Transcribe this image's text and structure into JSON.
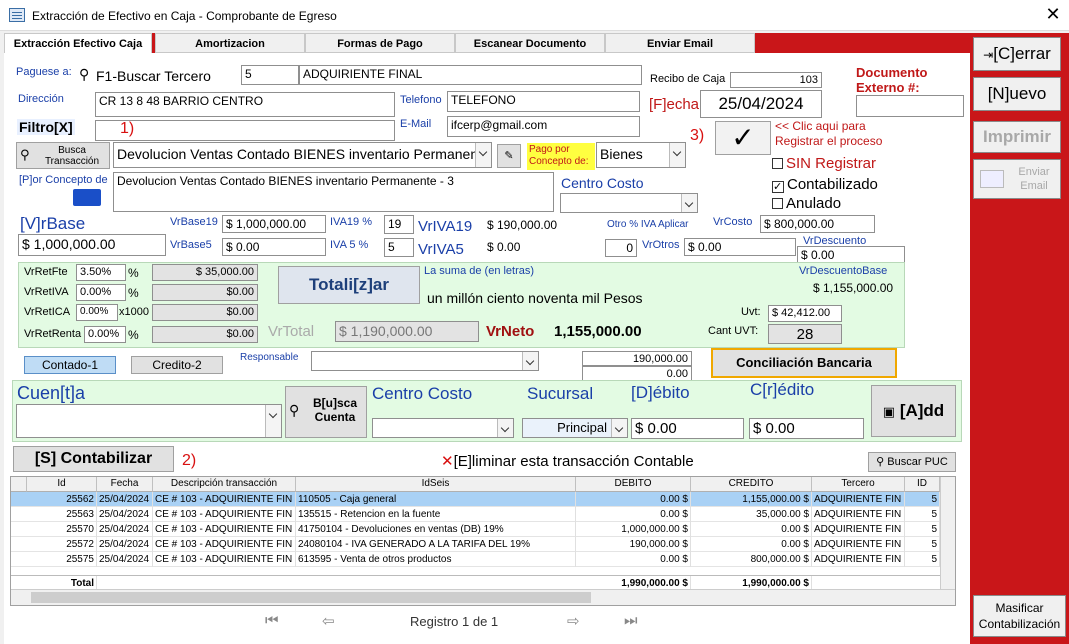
{
  "window": {
    "title": "Extracción de Efectivo en Caja - Comprobante de Egreso",
    "close": "✕"
  },
  "tabs": [
    "Extracción Efectivo Caja",
    "Amortizacion",
    "Formas de Pago",
    "Escanear Documento",
    "Enviar Email"
  ],
  "sidebar": {
    "cerrar": "[C]errar",
    "nuevo": "[N]uevo",
    "imprimir": "Imprimir",
    "enviar_email": "Enviar Email",
    "masificar": "Masificar Contabilización"
  },
  "header": {
    "paguese_label": "Paguese a:",
    "buscar_tercero": "F1-Buscar Tercero",
    "tercero_id": "5",
    "tercero_nombre": "ADQUIRIENTE  FINAL",
    "direccion_label": "Dirección",
    "direccion": "CR 13 8 48 BARRIO CENTRO",
    "telefono_label": "Telefono",
    "telefono": "TELEFONO",
    "email_label": "E-Mail",
    "email": "ifcerp@gmail.com",
    "filtro_label": "Filtro[X]",
    "filtro_value": "",
    "recibo_label": "Recibo de Caja",
    "recibo": "103",
    "fecha_label": "[F]echa",
    "fecha": "25/04/2024",
    "doc_externo_label": "Documento Externo #:",
    "doc_externo": "",
    "annot1": "1)",
    "annot2": "2)",
    "annot3": "3)",
    "busca_transaccion": "Busca Transacción",
    "transaccion": "Devolucion Ventas Contado BIENES inventario Permanente",
    "pago_concepto_label": "Pago por Concepto de:",
    "pago_concepto": "Bienes",
    "clic_registrar": "<< Clic aqui para Registrar el proceso",
    "sin_registrar": "SIN Registrar",
    "contabilizado": "Contabilizado",
    "anulado": "Anulado",
    "por_concepto_label": "[P]or Concepto de",
    "por_concepto": "Devolucion Ventas Contado BIENES inventario Permanente - 3",
    "centro_costo_label": "Centro Costo",
    "centro_costo": ""
  },
  "valores": {
    "vrbase_label": "[V]rBase",
    "vrbase": "$ 1,000,000.00",
    "vrbase19_label": "VrBase19",
    "vrbase19": "$ 1,000,000.00",
    "iva19_label": "IVA19 %",
    "iva19": "19",
    "vriva19_label": "VrIVA19",
    "vriva19": "$ 190,000.00",
    "vrbase5_label": "VrBase5",
    "vrbase5": "$ 0.00",
    "iva5_label": "IVA 5 %",
    "iva5": "5",
    "vriva5_label": "VrIVA5",
    "vriva5": "$ 0.00",
    "otro_iva_label": "Otro % IVA Aplicar",
    "otro_iva": "0",
    "vrotros_label": "VrOtros",
    "vrotros": "$ 0.00",
    "vrcosto_label": "VrCosto",
    "vrcosto": "$ 800,000.00",
    "vrdescuento_label": "VrDescuento",
    "vrdescuento": "$ 0.00"
  },
  "retenciones": {
    "rete_fte_label": "VrRetFte",
    "rete_fte_pct": "3.50%",
    "rete_fte": "$ 35,000.00",
    "rete_iva_label": "VrRetIVA",
    "rete_iva_pct": "0.00%",
    "rete_iva": "$0.00",
    "rete_ica_label": "VrRetICA",
    "rete_ica_pct": "0.00%",
    "rete_ica_x": "x1000",
    "rete_ica": "$0.00",
    "rete_renta_label": "VrRetRenta",
    "rete_renta_pct": "0.00%",
    "rete_renta": "$0.00",
    "pct": "%",
    "totalizar": "Totali[z]ar",
    "suma_letras_label": "La suma de (en letras)",
    "suma_letras": "un millón ciento noventa mil Pesos",
    "vrdescuentobase_label": "VrDescuentoBase",
    "vrdescuentobase": "$ 1,155,000.00",
    "uvt_label": "Uvt:",
    "uvt": "$ 42,412.00",
    "cant_uvt_label": "Cant UVT:",
    "cant_uvt": "28",
    "vrtotal_label": "VrTotal",
    "vrtotal": "$ 1,190,000.00",
    "vrneto_label": "VrNeto",
    "vrneto": "1,155,000.00"
  },
  "pago": {
    "contado": "Contado-1",
    "credito": "Credito-2",
    "responsable_label": "Responsable",
    "responsable": "",
    "total1": "190,000.00",
    "total2": "0.00",
    "conciliacion": "Conciliación Bancaria"
  },
  "cuenta": {
    "cuenta_label": "Cuen[t]a",
    "buscar_cuenta": "B[u]sca Cuenta",
    "centro_costo_label": "Centro Costo",
    "sucursal_label": "Sucursal",
    "sucursal": "Principal",
    "debito_label": "[D]ébito",
    "debito": "$ 0.00",
    "credito_label": "C[r]édito",
    "credito": "$ 0.00",
    "add": "[A]dd"
  },
  "acciones": {
    "contabilizar": "[S] Contabilizar",
    "eliminar": "[E]liminar esta transacción Contable",
    "buscar_puc": "Buscar PUC"
  },
  "grid": {
    "headers": [
      "Id",
      "Fecha",
      "Descripción transacción",
      "IdSeis",
      "DEBITO",
      "CREDITO",
      "Tercero",
      "ID"
    ],
    "rows": [
      [
        "25562",
        "25/04/2024",
        "CE # 103 - ADQUIRIENTE  FIN",
        "110505 - Caja general",
        "0.00 $",
        "1,155,000.00 $",
        "ADQUIRIENTE  FIN",
        "5"
      ],
      [
        "25563",
        "25/04/2024",
        "CE # 103 - ADQUIRIENTE  FIN",
        "135515 - Retencion en la fuente",
        "0.00 $",
        "35,000.00 $",
        "ADQUIRIENTE  FIN",
        "5"
      ],
      [
        "25570",
        "25/04/2024",
        "CE # 103 - ADQUIRIENTE  FIN",
        "41750104 - Devoluciones  en ventas (DB) 19%",
        "1,000,000.00 $",
        "0.00 $",
        "ADQUIRIENTE  FIN",
        "5"
      ],
      [
        "25572",
        "25/04/2024",
        "CE # 103 - ADQUIRIENTE  FIN",
        "24080104 - IVA GENERADO A LA TARIFA DEL 19%",
        "190,000.00 $",
        "0.00 $",
        "ADQUIRIENTE  FIN",
        "5"
      ],
      [
        "25575",
        "25/04/2024",
        "CE # 103 - ADQUIRIENTE  FIN",
        "613595 - Venta de otros productos",
        "0.00 $",
        "800,000.00 $",
        "ADQUIRIENTE  FIN",
        "5"
      ]
    ],
    "total_label": "Total",
    "total_debito": "1,990,000.00 $",
    "total_credito": "1,990,000.00 $"
  },
  "footer": {
    "registro": "Registro 1 de 1"
  }
}
